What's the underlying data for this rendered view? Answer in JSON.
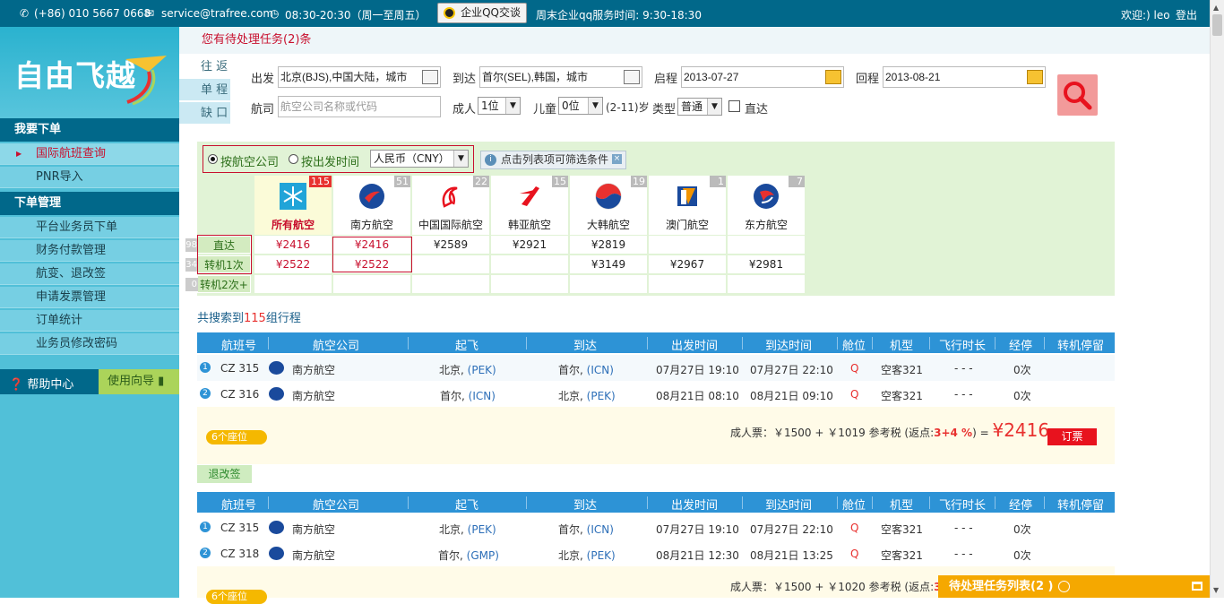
{
  "topbar": {
    "phone": "(+86) 010 5667 0668",
    "email": "service@trafree.com",
    "hours": "08:30-20:30（周一至周五）",
    "qq_button": "企业QQ交谈",
    "weekend": "周末企业qq服务时间: 9:30-18:30",
    "welcome": "欢迎:) leo",
    "logout": "登出"
  },
  "sidebar": {
    "logo_text": "自由飞越",
    "section1": "我要下单",
    "items1": [
      "国际航班查询",
      "PNR导入"
    ],
    "section2": "下单管理",
    "items2": [
      "平台业务员下单",
      "财务付款管理",
      "航变、退改签",
      "申请发票管理",
      "订单统计",
      "业务员修改密码"
    ],
    "help": "帮助中心",
    "guide": "使用向导"
  },
  "notice": "您有待处理任务(2)条",
  "trip_types": [
    "往 返",
    "单 程",
    "缺 口"
  ],
  "search": {
    "depart_label": "出发",
    "depart_value": "北京(BJS),中国大陆，城市",
    "arrive_label": "到达",
    "arrive_value": "首尔(SEL),韩国，城市",
    "outbound_label": "启程",
    "outbound_value": "2013-07-27",
    "return_label": "回程",
    "return_value": "2013-08-21",
    "airline_label": "航司",
    "airline_placeholder": "航空公司名称或代码",
    "adult_label": "成人",
    "adult_value": "1位",
    "child_label": "儿童",
    "child_value": "0位",
    "child_range": "(2-11)岁",
    "type_label": "类型",
    "type_value": "普通",
    "direct_label": "直达"
  },
  "matrix": {
    "sort_airline": "按航空公司",
    "sort_time": "按出发时间",
    "currency": "人民币（CNY）",
    "tip": "点击列表项可筛选条件",
    "airlines": [
      {
        "name": "所有航空",
        "count": "115"
      },
      {
        "name": "南方航空",
        "count": "51"
      },
      {
        "name": "中国国际航空",
        "count": "22"
      },
      {
        "name": "韩亚航空",
        "count": "15"
      },
      {
        "name": "大韩航空",
        "count": "19"
      },
      {
        "name": "澳门航空",
        "count": "1"
      },
      {
        "name": "东方航空",
        "count": "7"
      }
    ],
    "rows": [
      {
        "label": "直达",
        "count": "98",
        "prices": [
          "¥2416",
          "¥2416",
          "¥2589",
          "¥2921",
          "¥2819",
          "",
          ""
        ]
      },
      {
        "label": "转机1次",
        "count": "34",
        "prices": [
          "¥2522",
          "¥2522",
          "",
          "",
          "¥3149",
          "¥2967",
          "¥2981"
        ]
      },
      {
        "label": "转机2次+",
        "count": "0",
        "prices": [
          "",
          "",
          "",
          "",
          "",
          "",
          ""
        ]
      }
    ]
  },
  "total": {
    "prefix": "共搜索到",
    "count": "115",
    "suffix": "组行程"
  },
  "table_headers": [
    "航班号",
    "航空公司",
    "起飞",
    "到达",
    "出发时间",
    "到达时间",
    "舱位",
    "机型",
    "飞行时长",
    "经停",
    "转机停留"
  ],
  "results": [
    {
      "flights": [
        {
          "no": "1",
          "flight": "CZ 315",
          "airline": "南方航空",
          "from_city": "北京,",
          "from_code": "(PEK)",
          "to_city": "首尔,",
          "to_code": "(ICN)",
          "dep": "07月27日 19:10",
          "arr": "07月27日 22:10",
          "cabin": "Q",
          "aircraft": "空客321",
          "duration": "- - -",
          "stops": "0次"
        },
        {
          "no": "2",
          "flight": "CZ 316",
          "airline": "南方航空",
          "from_city": "首尔,",
          "from_code": "(ICN)",
          "to_city": "北京,",
          "to_code": "(PEK)",
          "dep": "08月21日 08:10",
          "arr": "08月21日 09:10",
          "cabin": "Q",
          "aircraft": "空客321",
          "duration": "- - -",
          "stops": "0次"
        }
      ],
      "price_prefix": "成人票：￥1500 + ￥1019 参考税 (返点:",
      "rebate": "3+4 %",
      "price_mid": ") =",
      "total": "¥2416",
      "seats": "6个座位",
      "book": "订票"
    },
    {
      "flights": [
        {
          "no": "1",
          "flight": "CZ 315",
          "airline": "南方航空",
          "from_city": "北京,",
          "from_code": "(PEK)",
          "to_city": "首尔,",
          "to_code": "(ICN)",
          "dep": "07月27日 19:10",
          "arr": "07月27日 22:10",
          "cabin": "Q",
          "aircraft": "空客321",
          "duration": "- - -",
          "stops": "0次"
        },
        {
          "no": "2",
          "flight": "CZ 318",
          "airline": "南方航空",
          "from_city": "首尔,",
          "from_code": "(GMP)",
          "to_city": "北京,",
          "to_code": "(PEK)",
          "dep": "08月21日 12:30",
          "arr": "08月21日 13:25",
          "cabin": "Q",
          "aircraft": "空客321",
          "duration": "- - -",
          "stops": "0次"
        }
      ],
      "price_prefix": "成人票：￥1500 + ￥1020 参考税 (返点:",
      "rebate": "3",
      "seats": "6个座位"
    }
  ],
  "retag": "退改签",
  "pending": "待处理任务列表(2 )"
}
